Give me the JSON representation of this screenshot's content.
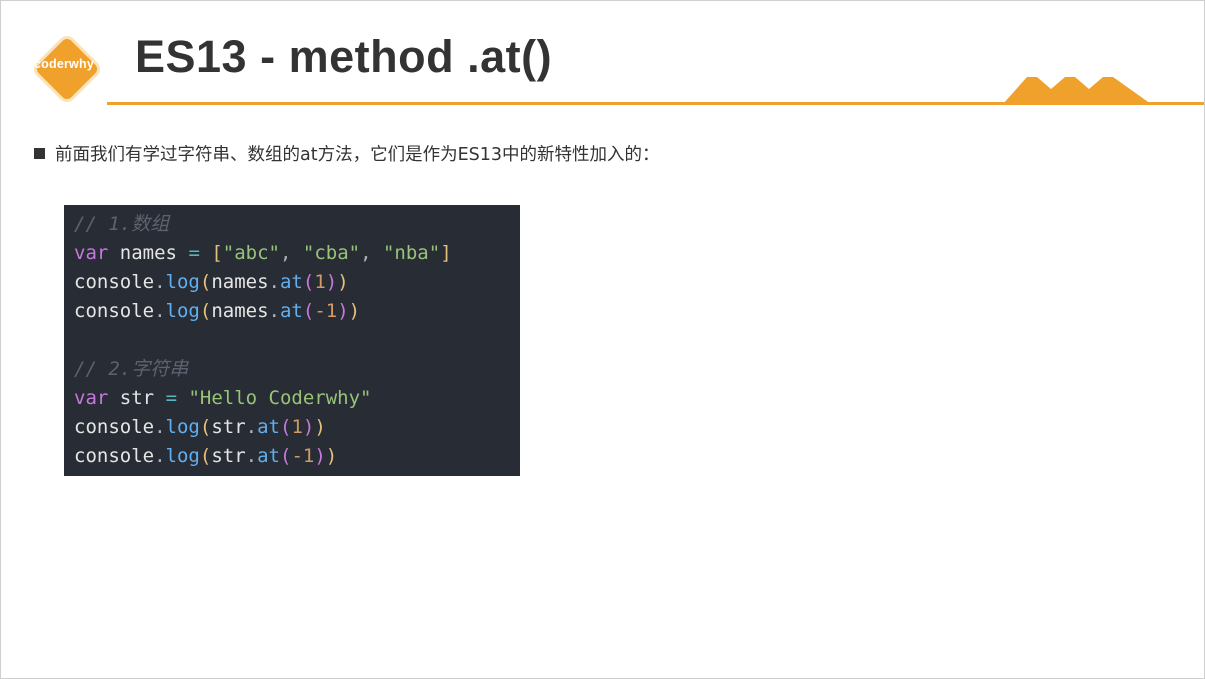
{
  "logo": {
    "text": "coderwhy"
  },
  "title": "ES13 - method .at()",
  "colors": {
    "accent": "#f0a12c",
    "code_bg": "#282c34",
    "text": "#333333"
  },
  "bullet": "前面我们有学过字符串、数组的at方法，它们是作为ES13中的新特性加入的：",
  "code": {
    "comment1": "// 1.数组",
    "l2_kw": "var",
    "l2_name": "names",
    "l2_eq": "=",
    "l2_open": "[",
    "l2_s1": "\"abc\"",
    "l2_s2": "\"cba\"",
    "l2_s3": "\"nba\"",
    "l2_close": "]",
    "l3_obj": "console",
    "l3_fn": "log",
    "l3_var": "names",
    "l3_at": "at",
    "l3_arg": "1",
    "l4_obj": "console",
    "l4_fn": "log",
    "l4_var": "names",
    "l4_at": "at",
    "l4_arg": "-1",
    "comment2": "// 2.字符串",
    "l7_kw": "var",
    "l7_name": "str",
    "l7_eq": "=",
    "l7_str": "\"Hello Coderwhy\"",
    "l8_obj": "console",
    "l8_fn": "log",
    "l8_var": "str",
    "l8_at": "at",
    "l8_arg": "1",
    "l9_obj": "console",
    "l9_fn": "log",
    "l9_var": "str",
    "l9_at": "at",
    "l9_arg": "-1"
  }
}
